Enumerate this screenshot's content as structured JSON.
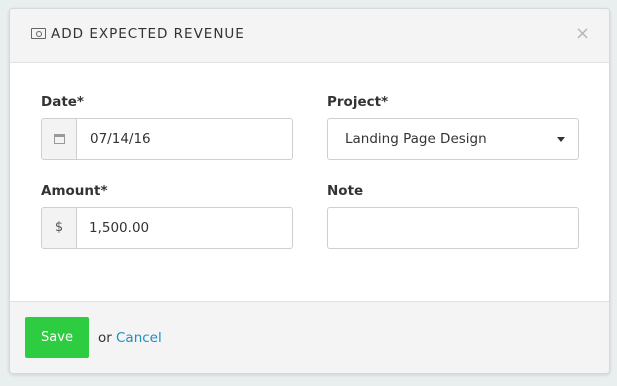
{
  "modal": {
    "title": "ADD EXPECTED REVENUE",
    "header_icon": "money-icon",
    "close_symbol": "×"
  },
  "form": {
    "date": {
      "label": "Date*",
      "value": "07/14/16",
      "icon": "calendar-icon"
    },
    "project": {
      "label": "Project*",
      "value": "Landing Page Design"
    },
    "amount": {
      "label": "Amount*",
      "currency": "$",
      "value": "1,500.00"
    },
    "note": {
      "label": "Note",
      "value": ""
    }
  },
  "footer": {
    "save_label": "Save",
    "or_text": "or",
    "cancel_label": "Cancel"
  },
  "colors": {
    "save_button": "#2ecc40",
    "cancel_link": "#1d8fc1"
  }
}
